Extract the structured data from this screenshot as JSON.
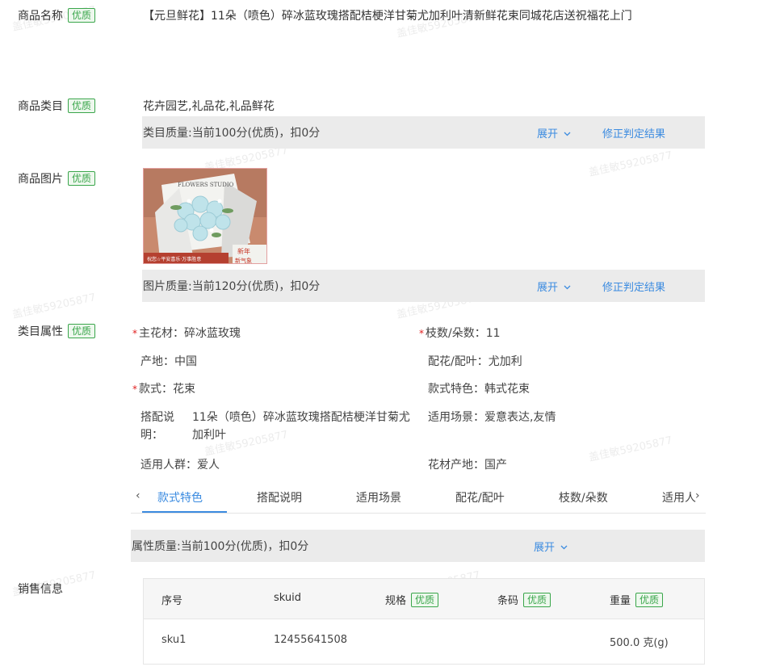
{
  "watermark": "盖佳敏59205877",
  "badge_text": "优质",
  "fields": {
    "name_label": "商品名称",
    "category_label": "商品类目",
    "image_label": "商品图片",
    "attr_label": "类目属性",
    "sales_label": "销售信息"
  },
  "product": {
    "title": "【元旦鲜花】11朵（喷色）碎冰蓝玫瑰搭配桔梗洋甘菊尤加利叶清新鲜花束同城花店送祝福花上门",
    "category": "花卉园艺,礼品花,礼品鲜花"
  },
  "image_overlay": {
    "sign": "FLOWERS STUDIO",
    "bottom": "祝您☆平安喜乐·万事胜意",
    "stamp_line1": "新年",
    "stamp_line2": "新气象"
  },
  "quality": {
    "category": "类目质量:当前100分(优质)，扣0分",
    "image": "图片质量:当前120分(优质)，扣0分",
    "attr": "属性质量:当前100分(优质)，扣0分",
    "expand": "展开",
    "expand_icon": "chevron-down-icon",
    "fix": "修正判定结果"
  },
  "attributes": {
    "main_flower_k": "主花材：",
    "main_flower_v": "碎冰蓝玫瑰",
    "count_k": "枝数/朵数：",
    "count_v": "11",
    "origin_k": "产地：",
    "origin_v": "中国",
    "filler_k": "配花/配叶：",
    "filler_v": "尤加利",
    "style_k": "款式：",
    "style_v": "花束",
    "style_feature_k": "款式特色：",
    "style_feature_v": "韩式花束",
    "match_desc_k": "搭配说明：",
    "match_desc_v": "11朵（喷色）碎冰蓝玫瑰搭配桔梗洋甘菊尤加利叶",
    "scene_k": "适用场景：",
    "scene_v": "爱意表达,友情",
    "crowd_k": "适用人群：",
    "crowd_v": "爱人",
    "flower_origin_k": "花材产地：",
    "flower_origin_v": "国产"
  },
  "tabs": {
    "prev": "‹",
    "next": "›",
    "items": [
      "款式特色",
      "搭配说明",
      "适用场景",
      "配花/配叶",
      "枝数/朵数",
      "适用人"
    ]
  },
  "sku_table": {
    "headers": [
      "序号",
      "skuid",
      "规格",
      "条码",
      "重量"
    ],
    "rows": [
      [
        "sku1",
        "12455641508",
        "",
        "",
        "500.0 克(g)"
      ]
    ]
  },
  "colors": {
    "accent": "#3b8be0",
    "badge_green": "#3aa64b",
    "required_red": "#e02020",
    "bar_gray": "#ebebeb"
  }
}
